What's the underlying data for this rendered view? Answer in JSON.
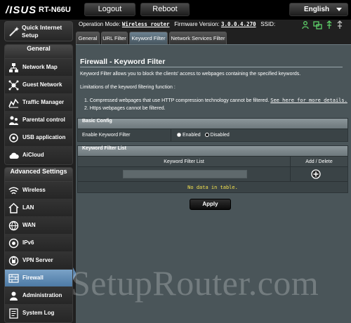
{
  "header": {
    "logo": "/ISUS",
    "model": "RT-N66U",
    "logout_label": "Logout",
    "reboot_label": "Reboot",
    "language": "English"
  },
  "status": {
    "op_mode_label": "Operation Mode:",
    "op_mode_value": "Wireless router",
    "firmware_label": "Firmware Version:",
    "firmware_value": "3.0.0.4.270",
    "ssid_label": "SSID:"
  },
  "sidebar": {
    "quick_setup": "Quick Internet Setup",
    "general_title": "General",
    "general_items": [
      "Network Map",
      "Guest Network",
      "Traffic Manager",
      "Parental control",
      "USB application",
      "AiCloud"
    ],
    "advanced_title": "Advanced Settings",
    "advanced_items": [
      "Wireless",
      "LAN",
      "WAN",
      "IPv6",
      "VPN Server",
      "Firewall",
      "Administration",
      "System Log"
    ],
    "active_item": "Firewall"
  },
  "tabs": [
    "General",
    "URL Filter",
    "Keyword Filter",
    "Network Services Filter"
  ],
  "active_tab": "Keyword Filter",
  "page": {
    "title": "Firewall - Keyword Filter",
    "description": "Keyword Filter allows you to block the clients' access to webpages containing the specified keywords.",
    "limitations_title": "Limitations of the keyword filtering function :",
    "limitation_1": "1.   Compressed webpages that use HTTP compression technology cannot be filtered.",
    "limitation_1_link": "See here for more details.",
    "limitation_2": "2.   Https webpages cannot be filtered."
  },
  "basic_config": {
    "header": "Basic Config",
    "field_label": "Enable Keyword Filter",
    "option_enabled": "Enabled",
    "option_disabled": "Disabled",
    "selected": "Disabled"
  },
  "keyword_list": {
    "header": "Keyword Filter List",
    "col_list": "Keyword Filter List",
    "col_action": "Add / Delete",
    "input_value": "",
    "empty_text": "No data in table."
  },
  "apply_label": "Apply",
  "watermark": "SetupRouter.com",
  "colors": {
    "panel_bg": "#4a5559",
    "active_nav": "#5d86ae",
    "empty_text": "#f4e24f"
  }
}
